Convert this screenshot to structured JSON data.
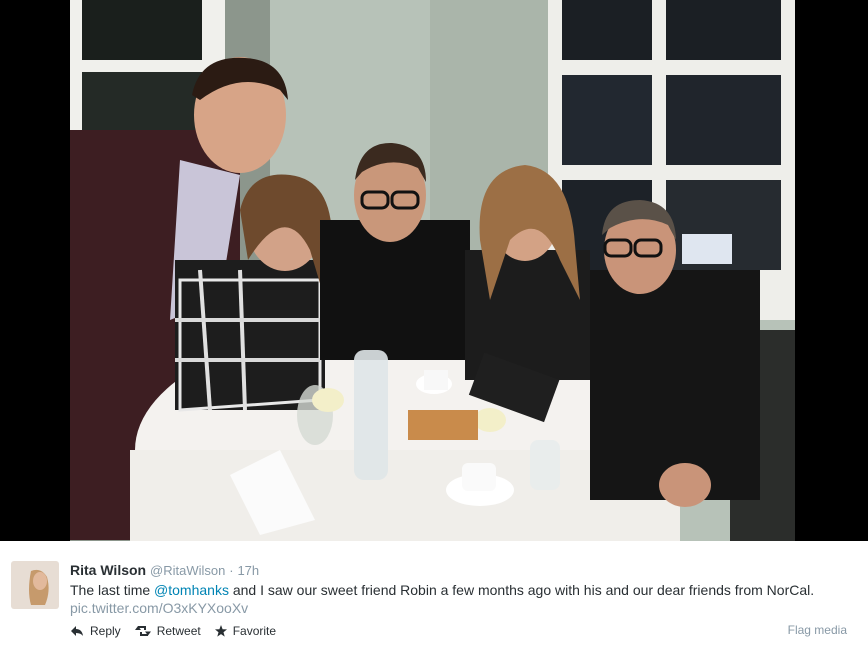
{
  "tweet": {
    "author_name": "Rita Wilson",
    "author_handle": "@RitaWilson",
    "separator": "·",
    "timestamp": "17h",
    "text_before": "The last time ",
    "mention": "@tomhanks",
    "text_after": " and I saw our sweet friend Robin a few months ago with his and our dear friends from NorCal.",
    "pic_link": "pic.twitter.com/O3xKYXooXv",
    "avatar_text": "Rita\nWilson"
  },
  "actions": {
    "reply_label": "Reply",
    "retweet_label": "Retweet",
    "favorite_label": "Favorite",
    "flag_label": "Flag media"
  },
  "icons": {
    "reply": "reply-icon",
    "retweet": "retweet-icon",
    "favorite": "star-icon"
  },
  "colors": {
    "link": "#0084b4",
    "muted": "#8899a6",
    "text": "#292f33"
  }
}
